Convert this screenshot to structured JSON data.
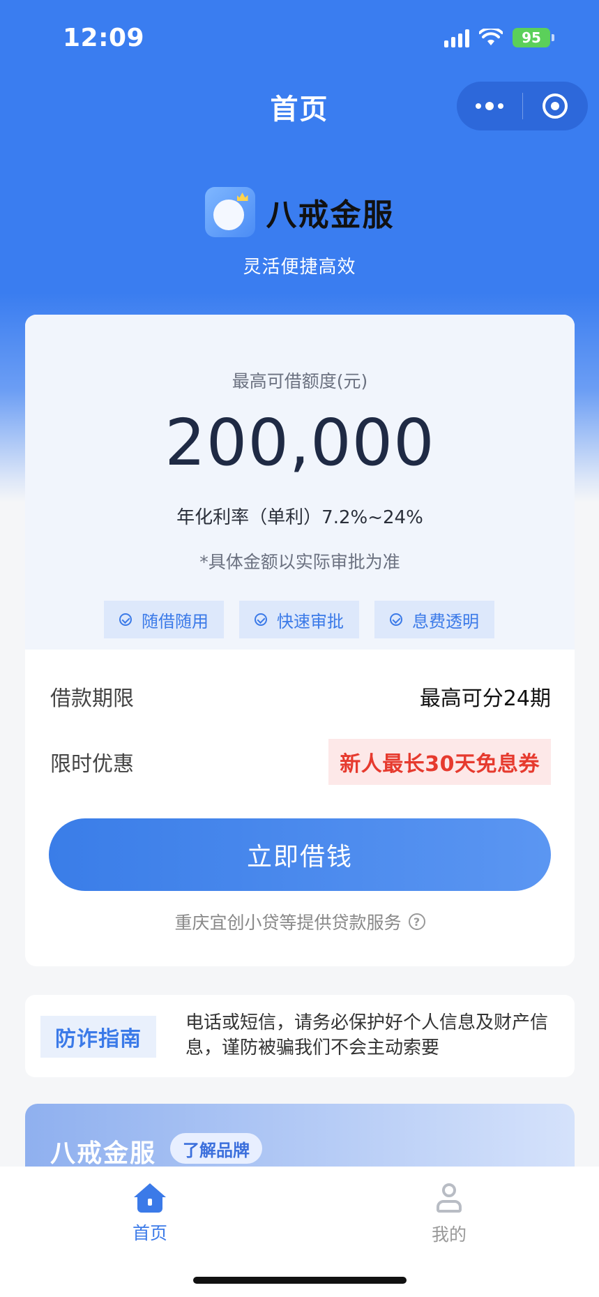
{
  "status_bar": {
    "time": "12:09",
    "battery": "95"
  },
  "nav": {
    "title": "首页"
  },
  "brand": {
    "name": "八戒金服",
    "slogan": "灵活便捷高效"
  },
  "loan_card": {
    "limit_label": "最高可借额度(元)",
    "limit_value": "200,000",
    "rate_text": "年化利率（单利）7.2%~24%",
    "note": "*具体金额以实际审批为准",
    "tags": [
      "随借随用",
      "快速审批",
      "息费透明"
    ],
    "term_label": "借款期限",
    "term_value": "最高可分24期",
    "promo_label": "限时优惠",
    "promo_value": "新人最长30天免息券",
    "cta_label": "立即借钱",
    "provider_text": "重庆宜创小贷等提供贷款服务"
  },
  "fraud": {
    "badge": "防诈指南",
    "text": "电话或短信，请务必保护好个人信息及财产信息，谨防被骗我们不会主动索要"
  },
  "brand_banner": {
    "title": "八戒金服",
    "chip": "了解品牌"
  },
  "tabbar": {
    "items": [
      {
        "label": "首页",
        "icon": "home-icon",
        "active": true
      },
      {
        "label": "我的",
        "icon": "user-icon",
        "active": false
      }
    ]
  },
  "colors": {
    "primary": "#3a7df0",
    "promo_text": "#e63a2e",
    "promo_bg": "#fde8e8"
  }
}
